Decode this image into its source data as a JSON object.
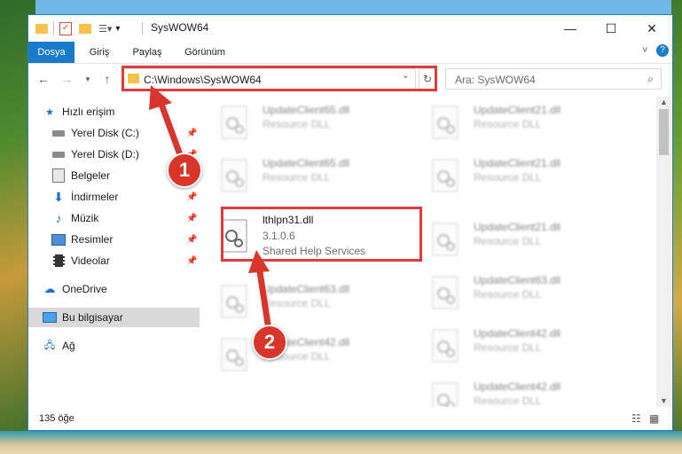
{
  "window": {
    "title": "SysWOW64"
  },
  "ribbon": {
    "tabs": [
      "Dosya",
      "Giriş",
      "Paylaş",
      "Görünüm"
    ]
  },
  "address": {
    "path": "C:\\Windows\\SysWOW64"
  },
  "search": {
    "placeholder": "Ara: SysWOW64"
  },
  "sidebar": {
    "items": [
      {
        "label": "Hızlı erişim",
        "icon": "star-icon"
      },
      {
        "label": "Yerel Disk (C:)",
        "icon": "drive-icon",
        "pinned": true
      },
      {
        "label": "Yerel Disk (D:)",
        "icon": "drive-icon",
        "pinned": true
      },
      {
        "label": "Belgeler",
        "icon": "documents-icon",
        "pinned": true
      },
      {
        "label": "İndirmeler",
        "icon": "download-icon",
        "pinned": true
      },
      {
        "label": "Müzik",
        "icon": "music-icon",
        "pinned": true
      },
      {
        "label": "Resimler",
        "icon": "pictures-icon",
        "pinned": true
      },
      {
        "label": "Videolar",
        "icon": "video-icon",
        "pinned": true
      },
      {
        "label": "OneDrive",
        "icon": "cloud-icon"
      },
      {
        "label": "Bu bilgisayar",
        "icon": "computer-icon",
        "selected": true
      },
      {
        "label": "Ağ",
        "icon": "network-icon"
      }
    ]
  },
  "files": {
    "left": [
      {
        "name": "UpdateClient65.dll",
        "sub": "Resource DLL",
        "blurred": true
      },
      {
        "name": "UpdateClient65.dll",
        "sub": "Resource DLL",
        "blurred": true
      },
      {
        "name": "lthlpn31.dll",
        "version": "3.1.0.6",
        "sub": "Shared Help Services",
        "blurred": false
      },
      {
        "name": "UpdateClient63.dll",
        "sub": "Resource DLL",
        "blurred": true
      },
      {
        "name": "UpdateClient42.dll",
        "sub": "Resource DLL",
        "blurred": true
      }
    ],
    "right": [
      {
        "name": "UpdateClient21.dll",
        "sub": "Resource DLL"
      },
      {
        "name": "UpdateClient21.dll",
        "sub": "Resource DLL"
      },
      {
        "name": "UpdateClient21.dll",
        "sub": "Resource DLL"
      },
      {
        "name": "UpdateClient63.dll",
        "sub": "Resource DLL"
      },
      {
        "name": "UpdateClient42.dll",
        "sub": "Resource DLL"
      },
      {
        "name": "UpdateClient42.dll",
        "sub": "Resource DLL"
      }
    ]
  },
  "status": {
    "count": "135 öğe"
  },
  "annotations": {
    "step1": "1",
    "step2": "2",
    "color": "#e03a3a"
  }
}
